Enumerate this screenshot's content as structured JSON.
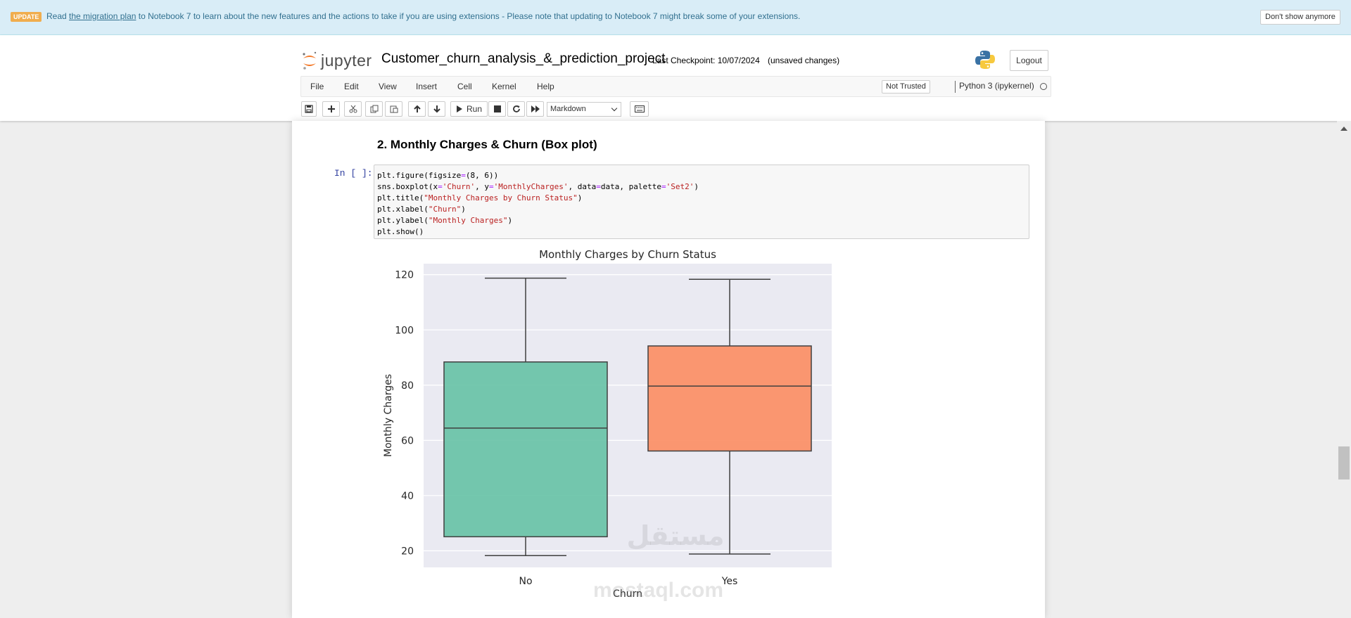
{
  "banner": {
    "badge": "UPDATE",
    "read": "Read",
    "link": "the migration plan",
    "message": "to Notebook 7 to learn about the new features and the actions to take if you are using extensions - Please note that updating to Notebook 7 might break some of your extensions.",
    "dismiss": "Don't show anymore"
  },
  "header": {
    "logo_text": "jupyter",
    "notebook_title": "Customer_churn_analysis_&_prediction_project",
    "checkpoint": "Last Checkpoint: 10/07/2024",
    "autosave": "(unsaved changes)",
    "logout": "Logout"
  },
  "menu": {
    "items": [
      "File",
      "Edit",
      "View",
      "Insert",
      "Cell",
      "Kernel",
      "Help"
    ],
    "trust": "Not Trusted",
    "kernel": "Python 3 (ipykernel)"
  },
  "toolbar": {
    "run_label": "Run",
    "cell_type": "Markdown",
    "icons": [
      "save-icon",
      "plus-icon",
      "cut-icon",
      "copy-icon",
      "paste-icon",
      "arrow-up-icon",
      "arrow-down-icon",
      "run-icon",
      "stop-icon",
      "restart-icon",
      "fast-forward-icon",
      "keyboard-icon"
    ]
  },
  "notebook": {
    "heading": "2. Monthly Charges & Churn (Box plot)",
    "prompt": "In [ ]:"
  },
  "watermark": {
    "arabic": "مستقل",
    "latin": "mostaql.com"
  },
  "chart_data": {
    "type": "box",
    "title": "Monthly Charges by Churn Status",
    "xlabel": "Churn",
    "ylabel": "Monthly Charges",
    "categories": [
      "No",
      "Yes"
    ],
    "boxes": [
      {
        "category": "No",
        "whislo": 18.25,
        "q1": 25.1,
        "med": 64.45,
        "q3": 88.4,
        "whishi": 118.75,
        "color": "#66c2a5"
      },
      {
        "category": "Yes",
        "whislo": 18.85,
        "q1": 56.15,
        "med": 79.65,
        "q3": 94.2,
        "whishi": 118.35,
        "color": "#fc8d62"
      }
    ],
    "ylim": [
      14,
      124
    ],
    "yticks": [
      20,
      40,
      60,
      80,
      100,
      120
    ],
    "grid": true,
    "style": "seaborn-darkgrid"
  },
  "colors": {
    "banner_bg": "#d9edf7",
    "banner_text": "#31708f",
    "badge": "#f0ad4e",
    "prompt": "#303f9f",
    "string": "#ba2121",
    "plot_bg": "#eaeaf2"
  }
}
